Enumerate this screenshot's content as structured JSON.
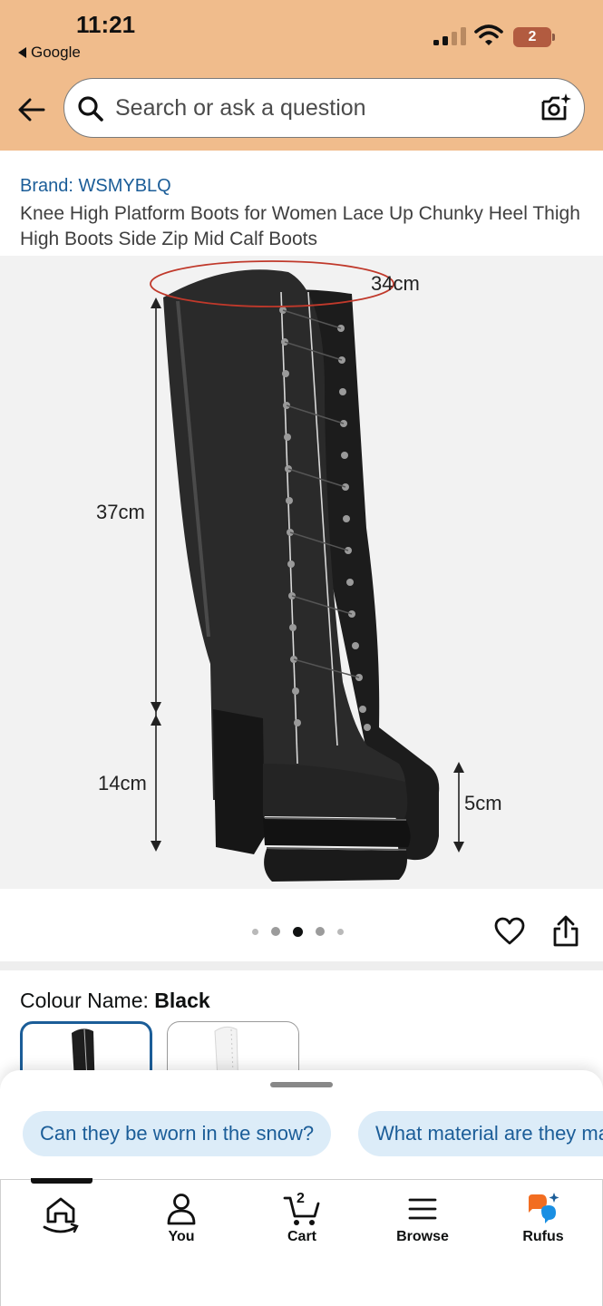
{
  "status_bar": {
    "time": "11:21",
    "back_app": "Google",
    "battery_level": "2"
  },
  "header": {
    "back_icon": "arrow-left-icon",
    "search": {
      "placeholder": "Search or ask a question",
      "value": ""
    },
    "camera_icon": "camera-sparkle-icon"
  },
  "product": {
    "brand": "Brand: WSMYBLQ",
    "title": "Knee High Platform Boots for Women Lace Up Chunky Heel Thigh High Boots Side Zip Mid Calf Boots"
  },
  "image": {
    "measurements": {
      "circumference": "34cm",
      "shaft_height": "37cm",
      "heel_height": "14cm",
      "platform_height": "5cm"
    },
    "dots_total": 5,
    "dots_active_index": 2
  },
  "actions": {
    "wishlist_icon": "heart-icon",
    "share_icon": "share-icon"
  },
  "colour": {
    "label": "Colour Name: ",
    "selected": "Black",
    "swatches": [
      "black",
      "white"
    ]
  },
  "rufus_sheet": {
    "chips": [
      "Can they be worn in the snow?",
      "What material are they made of?"
    ]
  },
  "tabbar": {
    "tabs": [
      {
        "label": "",
        "icon": "home-icon"
      },
      {
        "label": "You",
        "icon": "person-icon"
      },
      {
        "label": "Cart",
        "icon": "cart-icon",
        "count": "2"
      },
      {
        "label": "Browse",
        "icon": "menu-icon"
      },
      {
        "label": "Rufus",
        "icon": "rufus-icon"
      }
    ],
    "active_index": 0
  },
  "colors": {
    "header_bg": "#f0bc8c",
    "link_blue": "#1b5d98",
    "chip_bg": "#dcecf8",
    "measure_red": "#c0392b"
  }
}
